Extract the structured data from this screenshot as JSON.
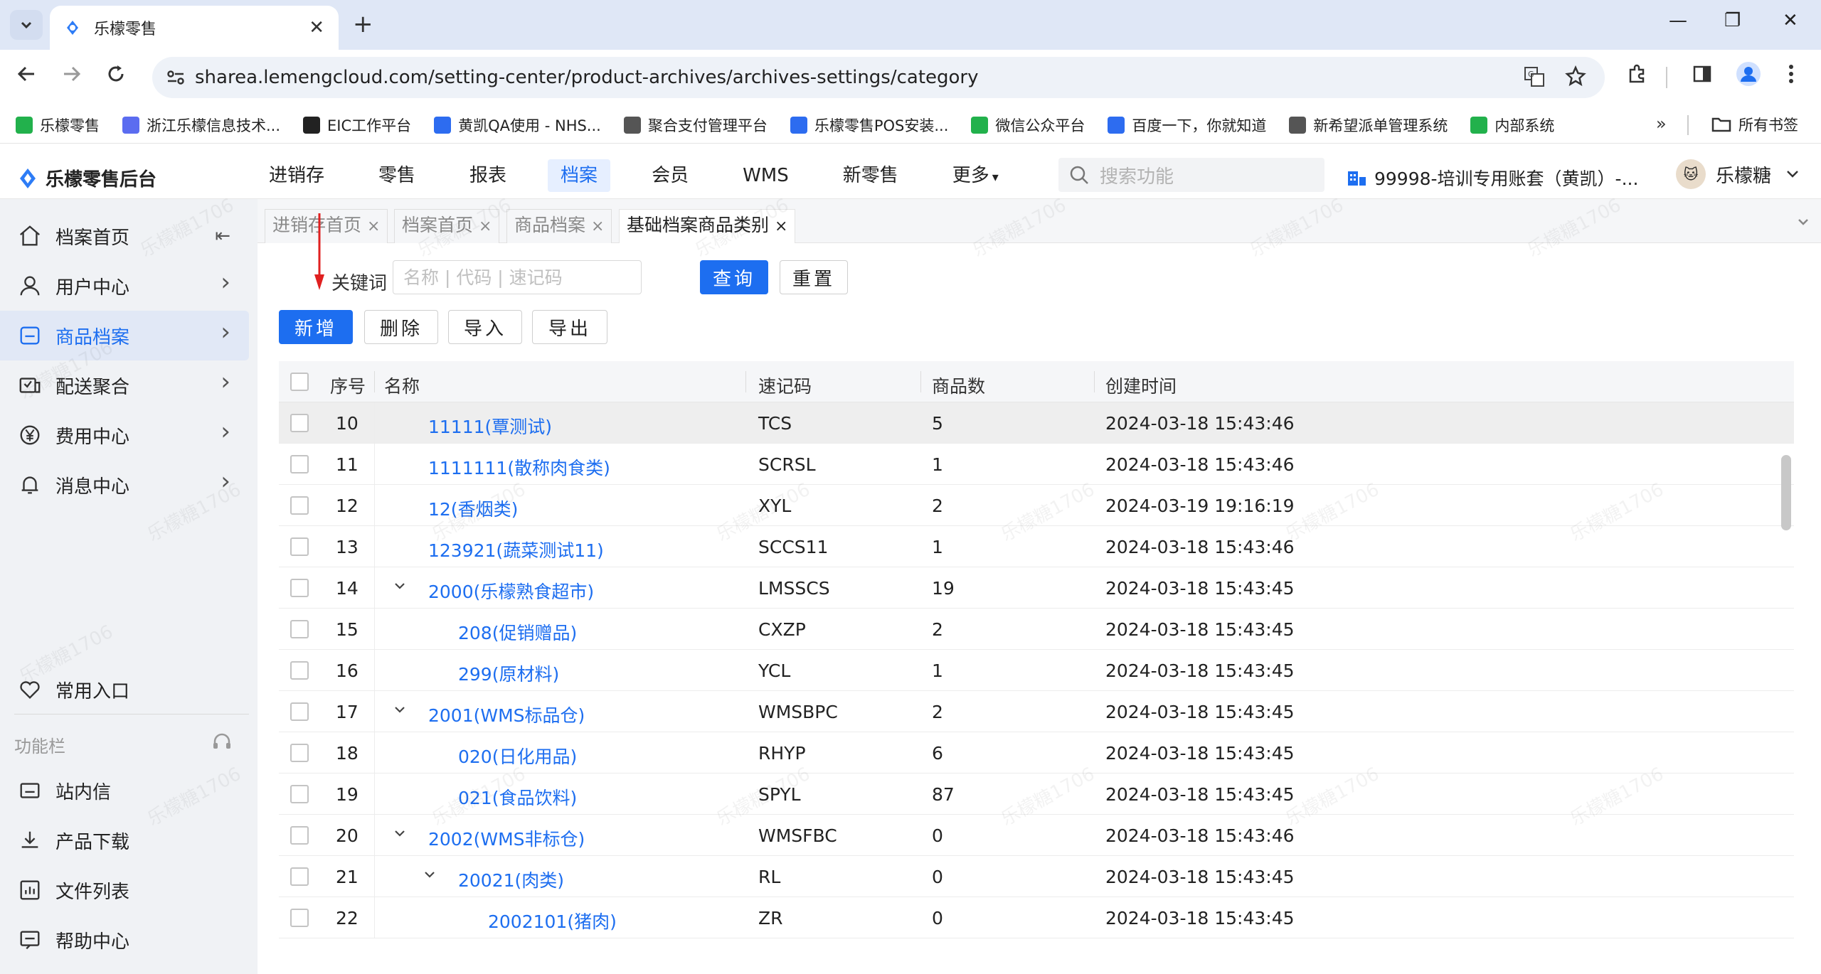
{
  "browser": {
    "tab_title": "乐檬零售",
    "url": "sharea.lemengcloud.com/setting-center/product-archives/archives-settings/category",
    "bookmarks": [
      {
        "label": "乐檬零售",
        "color": "#22b14c"
      },
      {
        "label": "浙江乐檬信息技术...",
        "color": "#5b6cf0"
      },
      {
        "label": "EIC工作平台",
        "color": "#222222"
      },
      {
        "label": "黄凯QA使用 - NHS...",
        "color": "#2d6cf0"
      },
      {
        "label": "聚合支付管理平台",
        "color": "#555555"
      },
      {
        "label": "乐檬零售POS安装...",
        "color": "#2d6cf0"
      },
      {
        "label": "微信公众平台",
        "color": "#22b14c"
      },
      {
        "label": "百度一下，你就知道",
        "color": "#2d6cf0"
      },
      {
        "label": "新希望派单管理系统",
        "color": "#555555"
      },
      {
        "label": "内部系统",
        "color": "#22b14c"
      }
    ],
    "all_bookmarks": "所有书签"
  },
  "app": {
    "logo_text": "乐檬零售后台",
    "nav": [
      "进销存",
      "零售",
      "报表",
      "档案",
      "会员",
      "WMS",
      "新零售",
      "更多"
    ],
    "active_nav_index": 3,
    "search_placeholder": "搜索功能",
    "account": "99998-培训专用账套（黄凯）-...",
    "user_name": "乐檬糖",
    "accent_color": "#1d6ef0"
  },
  "sidebar": {
    "top_items": [
      {
        "label": "档案首页",
        "icon": "home-icon"
      },
      {
        "label": "用户中心",
        "icon": "user-icon"
      },
      {
        "label": "商品档案",
        "icon": "product-icon",
        "active": true
      },
      {
        "label": "配送聚合",
        "icon": "delivery-icon"
      },
      {
        "label": "费用中心",
        "icon": "yen-icon"
      },
      {
        "label": "消息中心",
        "icon": "bell-icon"
      }
    ],
    "favorites_label": "常用入口",
    "section_label": "功能栏",
    "bottom_items": [
      {
        "label": "站内信",
        "icon": "mail-icon"
      },
      {
        "label": "产品下载",
        "icon": "download-icon"
      },
      {
        "label": "文件列表",
        "icon": "file-list-icon"
      },
      {
        "label": "帮助中心",
        "icon": "help-icon"
      }
    ]
  },
  "page_tabs": [
    {
      "label": "进销存首页"
    },
    {
      "label": "档案首页"
    },
    {
      "label": "商品档案"
    },
    {
      "label": "基础档案商品类别",
      "active": true
    }
  ],
  "filter": {
    "keyword_label": "关键词",
    "keyword_placeholder": "名称 | 代码 | 速记码",
    "keyword_value": "",
    "query_button": "查询",
    "reset_button": "重置"
  },
  "actions": {
    "add": "新增",
    "delete": "删除",
    "import": "导入",
    "export": "导出"
  },
  "table": {
    "columns": [
      "序号",
      "名称",
      "速记码",
      "商品数",
      "创建时间"
    ],
    "rows": [
      {
        "no": "10",
        "name": "11111(覃测试)",
        "code": "TCS",
        "count": "5",
        "created": "2024-03-18 15:43:46",
        "level": 1,
        "expanded": false
      },
      {
        "no": "11",
        "name": "1111111(散称肉食类)",
        "code": "SCRSL",
        "count": "1",
        "created": "2024-03-18 15:43:46",
        "level": 1,
        "expanded": false
      },
      {
        "no": "12",
        "name": "12(香烟类)",
        "code": "XYL",
        "count": "2",
        "created": "2024-03-19 19:16:19",
        "level": 1,
        "expanded": false
      },
      {
        "no": "13",
        "name": "123921(蔬菜测试11)",
        "code": "SCCS11",
        "count": "1",
        "created": "2024-03-18 15:43:46",
        "level": 1,
        "expanded": false
      },
      {
        "no": "14",
        "name": "2000(乐檬熟食超市)",
        "code": "LMSSCS",
        "count": "19",
        "created": "2024-03-18 15:43:45",
        "level": 1,
        "expanded": true
      },
      {
        "no": "15",
        "name": "208(促销赠品)",
        "code": "CXZP",
        "count": "2",
        "created": "2024-03-18 15:43:45",
        "level": 2,
        "expanded": false
      },
      {
        "no": "16",
        "name": "299(原材料)",
        "code": "YCL",
        "count": "1",
        "created": "2024-03-18 15:43:45",
        "level": 2,
        "expanded": false
      },
      {
        "no": "17",
        "name": "2001(WMS标品仓)",
        "code": "WMSBPC",
        "count": "2",
        "created": "2024-03-18 15:43:45",
        "level": 1,
        "expanded": true
      },
      {
        "no": "18",
        "name": "020(日化用品)",
        "code": "RHYP",
        "count": "6",
        "created": "2024-03-18 15:43:45",
        "level": 2,
        "expanded": false
      },
      {
        "no": "19",
        "name": "021(食品饮料)",
        "code": "SPYL",
        "count": "87",
        "created": "2024-03-18 15:43:45",
        "level": 2,
        "expanded": false
      },
      {
        "no": "20",
        "name": "2002(WMS非标仓)",
        "code": "WMSFBC",
        "count": "0",
        "created": "2024-03-18 15:43:46",
        "level": 1,
        "expanded": true
      },
      {
        "no": "21",
        "name": "20021(肉类)",
        "code": "RL",
        "count": "0",
        "created": "2024-03-18 15:43:45",
        "level": 2,
        "expanded": true
      },
      {
        "no": "22",
        "name": "2002101(猪肉)",
        "code": "ZR",
        "count": "0",
        "created": "2024-03-18 15:43:45",
        "level": 3,
        "expanded": false
      }
    ]
  },
  "watermark_text": "乐檬糖1706"
}
